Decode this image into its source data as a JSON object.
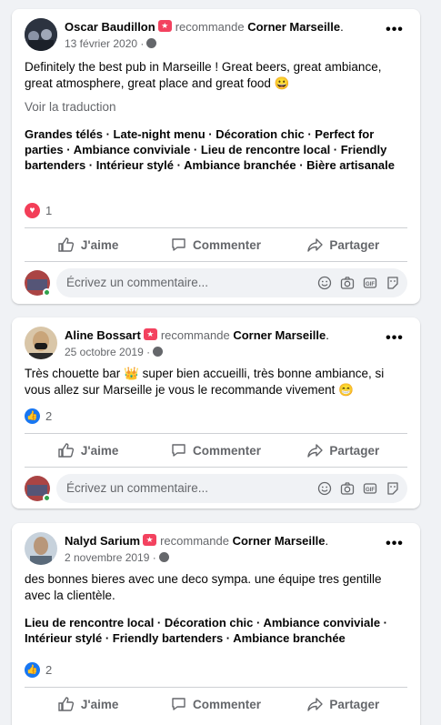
{
  "posts": [
    {
      "author": "Oscar Baudillon",
      "recommends": "recommande",
      "page": "Corner Marseille",
      "date": "13 février 2020",
      "text": "Definitely the best pub in Marseille ! Great beers, great ambiance, great atmosphere, great place and great food 😀",
      "translate": "Voir la traduction",
      "tags": "Grandes télés · Late-night menu · Décoration chic · Perfect for parties · Ambiance conviviale · Lieu de rencontre local · Friendly bartenders · Intérieur stylé · Ambiance branchée · Bière artisanale",
      "reaction_icon": "heart-icon",
      "reaction_count": "1",
      "actions": [
        "J'aime",
        "Commenter",
        "Partager"
      ],
      "comment_placeholder": "Écrivez un commentaire..."
    },
    {
      "author": "Aline Bossart",
      "recommends": "recommande",
      "page": "Corner Marseille",
      "date": "25 octobre 2019",
      "text": "Très chouette bar 👑 super bien accueilli, très bonne ambiance, si vous allez sur Marseille je vous le recommande vivement 😁",
      "reaction_icon": "like-icon",
      "reaction_count": "2",
      "actions": [
        "J'aime",
        "Commenter",
        "Partager"
      ],
      "comment_placeholder": "Écrivez un commentaire..."
    },
    {
      "author": "Nalyd Sarium",
      "recommends": "recommande",
      "page": "Corner Marseille",
      "date": "2 novembre 2019",
      "text": "des bonnes bieres avec une deco sympa. une équipe tres gentille avec la clientèle.",
      "tags": "Lieu de rencontre local · Décoration chic · Ambiance conviviale · Intérieur stylé · Friendly bartenders · Ambiance branchée",
      "reaction_icon": "like-icon",
      "reaction_count": "2",
      "actions": [
        "J'aime",
        "Commenter",
        "Partager"
      ]
    }
  ],
  "colors": {
    "background": "#f0f2f5",
    "secondary_text": "#65676b",
    "like_blue": "#1877f2",
    "heart_red": "#f33e58",
    "badge_red": "#f3425f"
  }
}
